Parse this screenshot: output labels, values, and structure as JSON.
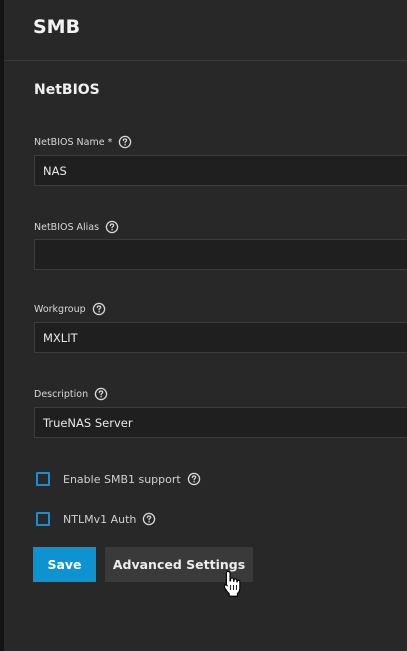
{
  "header": {
    "title": "SMB"
  },
  "netbios": {
    "section_title": "NetBIOS",
    "netbios_name": {
      "label": "NetBIOS Name *",
      "value": "NAS"
    },
    "netbios_alias": {
      "label": "NetBIOS Alias",
      "value": ""
    },
    "workgroup": {
      "label": "Workgroup",
      "value": "MXLIT"
    },
    "description": {
      "label": "Description",
      "value": "TrueNAS Server"
    }
  },
  "options": {
    "enable_smb1": {
      "label": "Enable SMB1 support",
      "checked": false
    },
    "ntlmv1_auth": {
      "label": "NTLMv1 Auth",
      "checked": false
    }
  },
  "actions": {
    "save_label": "Save",
    "advanced_label": "Advanced Settings"
  },
  "colors": {
    "background": "#282828",
    "primary": "#0d93d2",
    "secondary_button": "#3a3a3a",
    "checkbox_border": "#1a8fcf",
    "input_background": "#1f1f1f"
  },
  "icons": {
    "help": "help-circle-icon",
    "cursor": "hand-pointer-cursor-icon"
  }
}
